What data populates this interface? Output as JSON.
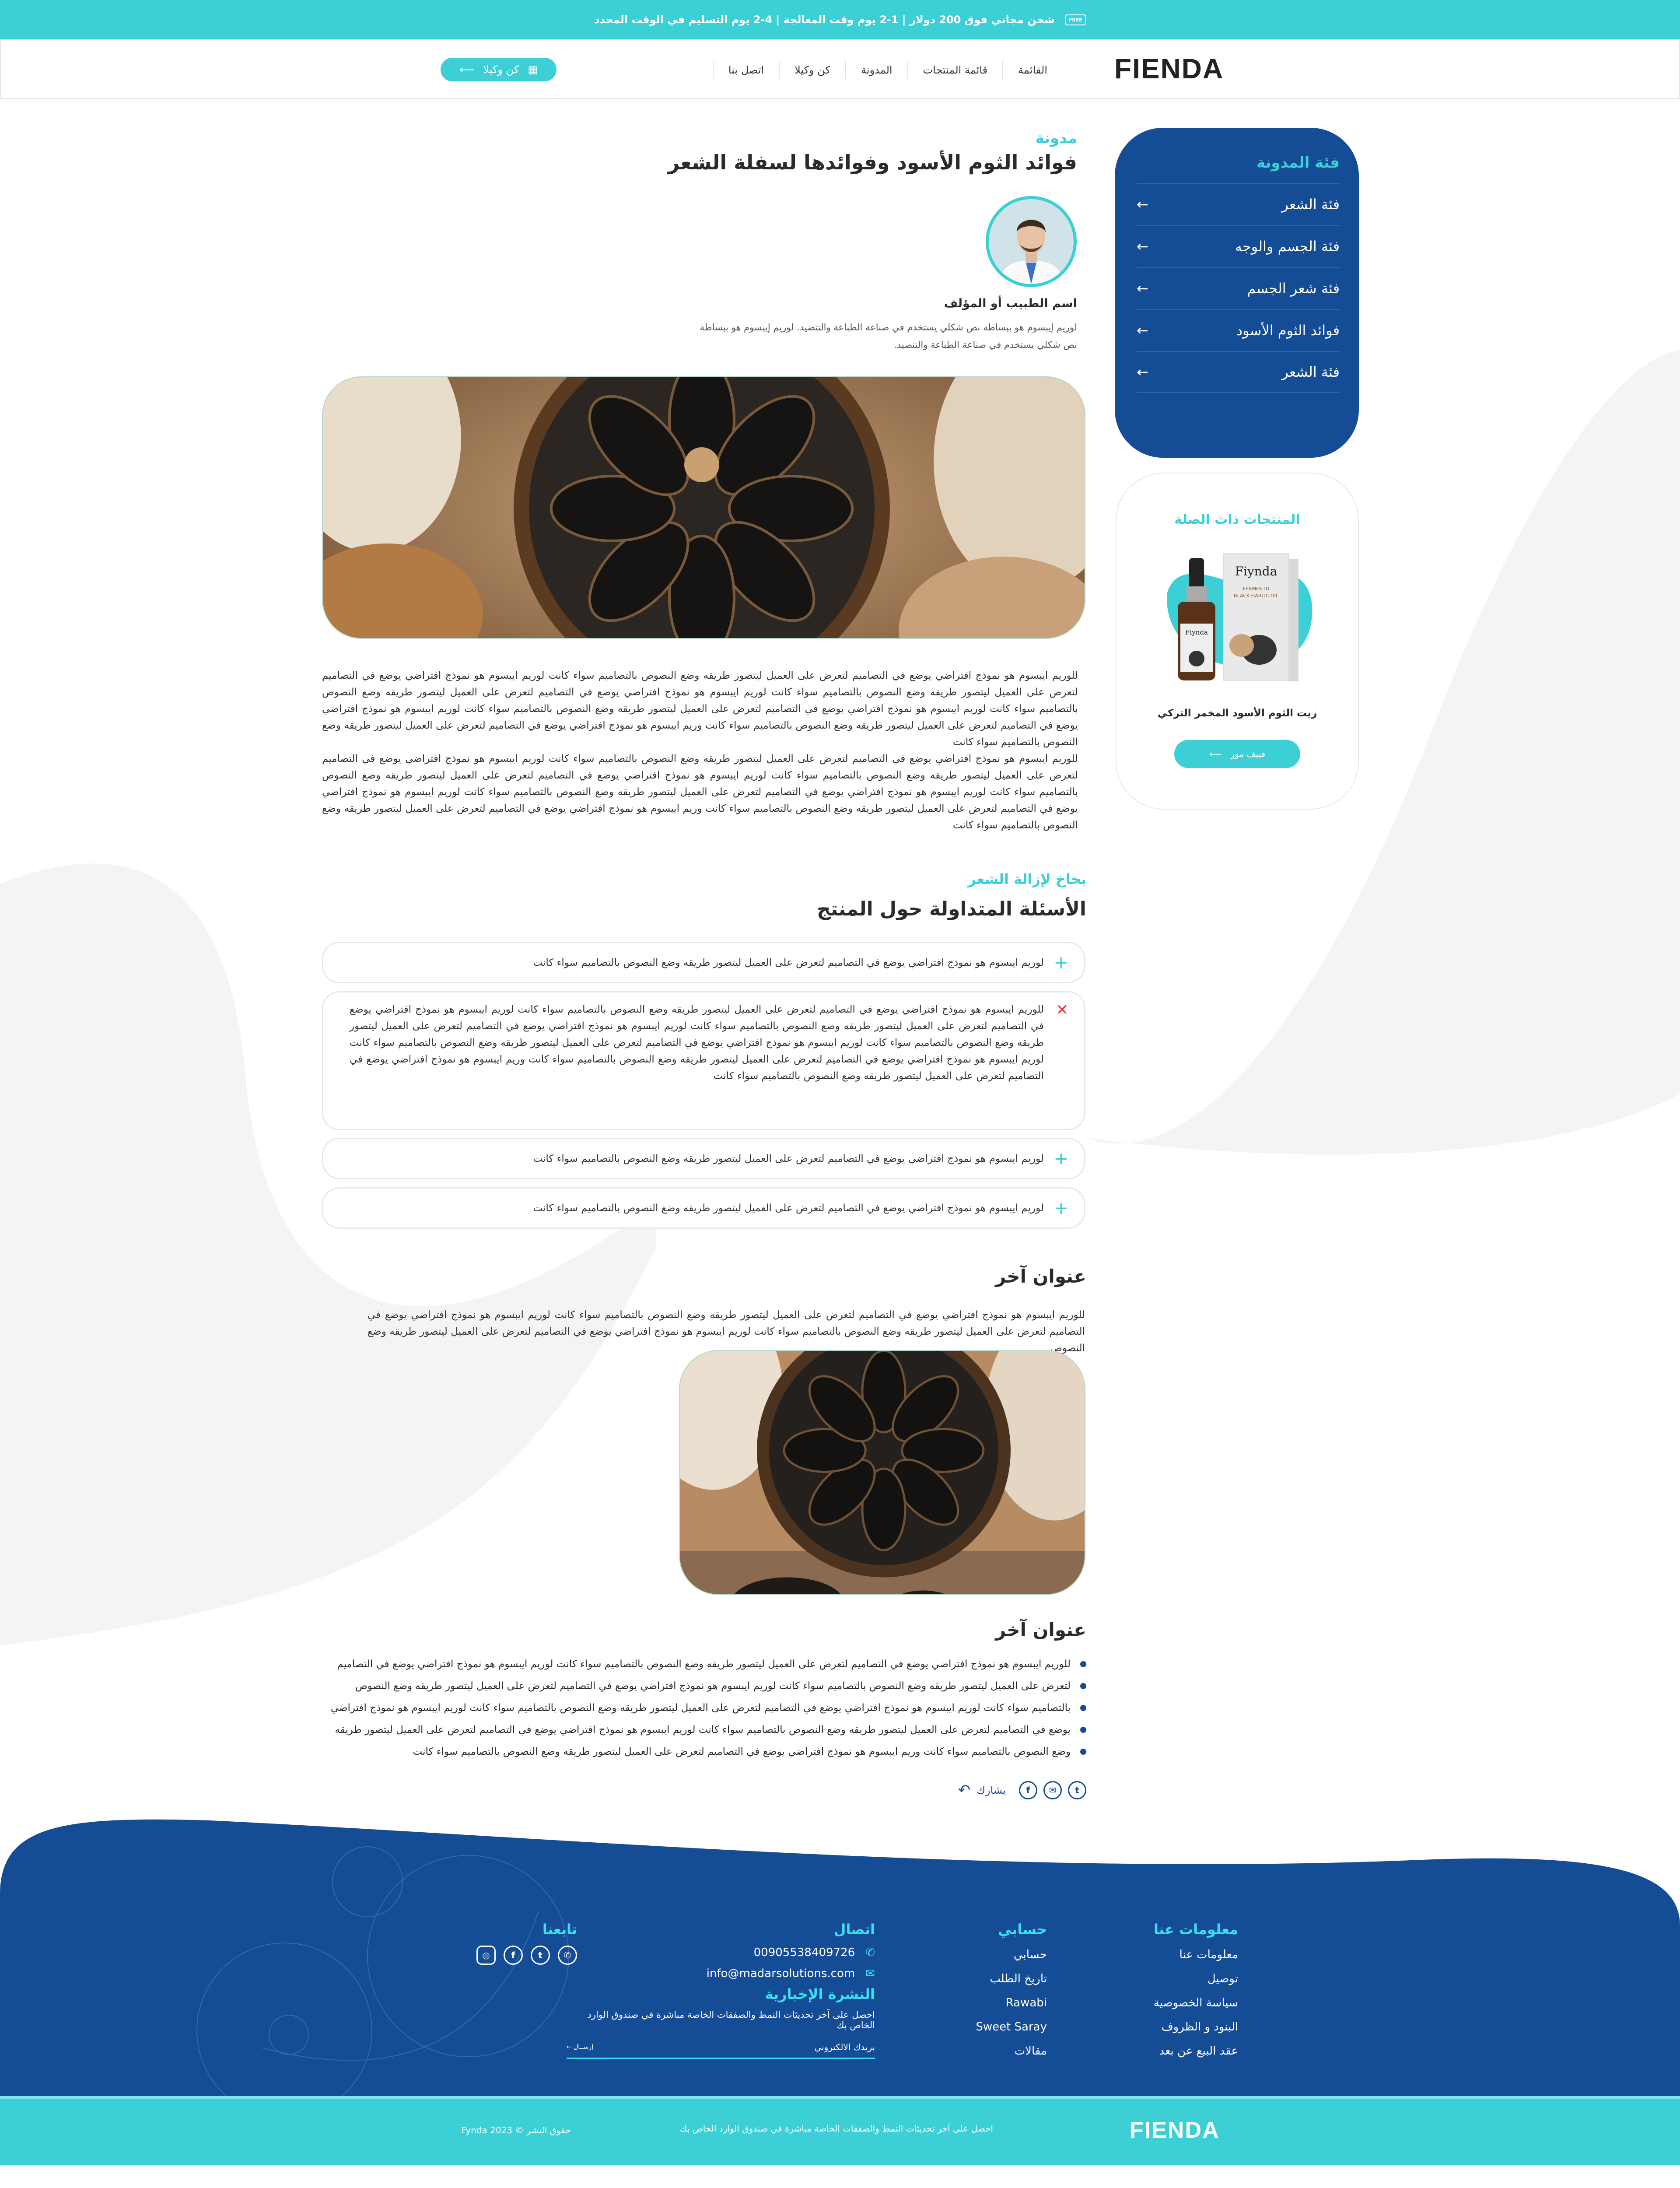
{
  "topbar": {
    "icon": "free-delivery-truck-icon",
    "badge": "FREE",
    "text": "شحن مجاني فوق 200 دولار | 1-2 يوم وقت المعالجة | 4-2 يوم التسليم في الوقت المحدد"
  },
  "header": {
    "logo": "FIENDA",
    "nav": [
      "القائمة",
      "قائمة المنتجات",
      "المدونة",
      "كن وكيلا",
      "اتصل بنا"
    ],
    "cta_label": "كن وكيلا",
    "cta_icon": "store-icon"
  },
  "sidebar": {
    "title": "فئة المدونة",
    "items": [
      "فئة الشعر",
      "فئة الجسم والوجه",
      "فئة شعر الجسم",
      "فوائد الثوم الأسود",
      "فئة الشعر"
    ]
  },
  "related": {
    "title": "المنتجات ذات الصلة",
    "brand": "Fiynda",
    "product_line1": "FERMENTD",
    "product_line2": "BLACK GARLIC OIL",
    "product_name": "زيت الثوم الأسود المخمر التركي",
    "button": "فييف مور"
  },
  "article": {
    "tag": "مدونة",
    "title": "فوائد الثوم الأسود وفوائدها لسفلة الشعر",
    "author": "اسم الطبيب أو المؤلف",
    "author_bio": "لوريم إيبسوم هو ببساطة نص شكلي يستخدم في صناعة الطباعة والتنضيد. لوريم إيبسوم هو ببساطة نص شكلي يستخدم في صناعة الطباعة والتنضيد.",
    "paragraphs": [
      "للوريم ايبسوم هو نموذج افتراضي يوضع في التصاميم لتعرض على العميل ليتصور طريقه وضع النصوص بالتصاميم سواء كانت لوريم ايبسوم هو نموذج افتراضي يوضع في التصاميم لتعرض على العميل ليتصور طريقه وضع النصوص بالتصاميم سواء كانت لوريم ايبسوم هو نموذج افتراضي يوضع في التصاميم لتعرض على العميل ليتصور طريقه وضع النصوص بالتصاميم سواء كانت لوريم ايبسوم هو نموذج افتراضي يوضع في التصاميم لتعرض على العميل ليتصور طريقه وضع النصوص بالتصاميم سواء كانت لوريم ايبسوم هو نموذج افتراضي يوضع في التصاميم لتعرض على العميل ليتصور طريقه وضع النصوص بالتصاميم سواء كانت وريم ايبسوم هو نموذج افتراضي يوضع في التصاميم لتعرض على العميل ليتصور طريقه وضع النصوص بالتصاميم سواء كانت",
      "للوريم ايبسوم هو نموذج افتراضي يوضع في التصاميم لتعرض على العميل ليتصور طريقه وضع النصوص بالتصاميم سواء كانت لوريم ايبسوم هو نموذج افتراضي يوضع في التصاميم لتعرض على العميل ليتصور طريقه وضع النصوص بالتصاميم سواء كانت لوريم ايبسوم هو نموذج افتراضي يوضع في التصاميم لتعرض على العميل ليتصور طريقه وضع النصوص بالتصاميم سواء كانت لوريم ايبسوم هو نموذج افتراضي يوضع في التصاميم لتعرض على العميل ليتصور طريقه وضع النصوص بالتصاميم سواء كانت لوريم ايبسوم هو نموذج افتراضي يوضع في التصاميم لتعرض على العميل ليتصور طريقه وضع النصوص بالتصاميم سواء كانت وريم ايبسوم هو نموذج افتراضي يوضع في التصاميم لتعرض على العميل ليتصور طريقه وضع النصوص بالتصاميم سواء كانت"
    ]
  },
  "faq": {
    "tag": "بخاخ لإزالة الشعر",
    "title": "الأسئلة المتداولة حول المنتج",
    "items": [
      {
        "q": "لوريم ايبسوم هو نموذج افتراضي يوضع في التصاميم لتعرض على العميل ليتصور طريقه وضع النصوص بالتصاميم سواء كانت",
        "open": false
      },
      {
        "q": "للوريم ايبسوم هو نموذج افتراضي يوضع في التصاميم لتعرض على العميل ليتصور طريقه وضع النصوص بالتصاميم سواء كانت لوريم ايبسوم هو نموذج افتراضي يوضع في التصاميم لتعرض على العميل ليتصور طريقه وضع النصوص بالتصاميم سواء كانت لوريم ايبسوم هو نموذج افتراضي يوضع في التصاميم لتعرض على العميل ليتصور طريقه وضع النصوص بالتصاميم سواء كانت لوريم ايبسوم هو نموذج افتراضي يوضع في التصاميم لتعرض على العميل ليتصور طريقه وضع النصوص بالتصاميم سواء كانت لوريم ايبسوم هو نموذج افتراضي يوضع في التصاميم لتعرض على العميل ليتصور طريقه وضع النصوص بالتصاميم سواء كانت وريم ايبسوم هو نموذج افتراضي يوضع في التصاميم لتعرض على العميل ليتصور طريقه وضع النصوص بالتصاميم سواء كانت",
        "open": true
      },
      {
        "q": "لوريم ايبسوم هو نموذج افتراضي يوضع في التصاميم لتعرض على العميل ليتصور طريقه وضع النصوص بالتصاميم سواء كانت",
        "open": false
      },
      {
        "q": "لوريم ايبسوم هو نموذج افتراضي يوضع في التصاميم لتعرض على العميل ليتصور طريقه وضع النصوص بالتصاميم سواء كانت",
        "open": false
      }
    ]
  },
  "section2": {
    "title": "عنوان آخر",
    "text": "للوريم ايبسوم هو نموذج افتراضي يوضع في التصاميم لتعرض على العميل ليتصور طريقه وضع النصوص بالتصاميم سواء كانت لوريم ايبسوم هو نموذج افتراضي يوضع في التصاميم لتعرض على العميل ليتصور طريقه وضع النصوص بالتصاميم سواء كانت لوريم ايبسوم هو نموذج افتراضي يوضع في التصاميم لتعرض على العميل ليتصور طريقه وضع النصوص"
  },
  "section3": {
    "title": "عنوان آخر",
    "bullets": [
      "للوريم ايبسوم هو نموذج افتراضي يوضع في التصاميم لتعرض على العميل ليتصور طريقه وضع النصوص بالتصاميم سواء كانت لوريم ايبسوم هو نموذج افتراضي يوضع في التصاميم",
      "لتعرض على العميل ليتصور طريقه وضع النصوص بالتصاميم سواء كانت لوريم ايبسوم هو نموذج افتراضي يوضع في التصاميم لتعرض على العميل ليتصور طريقه وضع النصوص",
      "بالتصاميم سواء كانت لوريم ايبسوم هو نموذج افتراضي يوضع في التصاميم لتعرض على العميل ليتصور طريقه وضع النصوص بالتصاميم سواء كانت لوريم ايبسوم هو نموذج افتراضي",
      "يوضع في التصاميم لتعرض على العميل ليتصور طريقه وضع النصوص بالتصاميم سواء كانت لوريم ايبسوم هو نموذج افتراضي يوضع في التصاميم لتعرض على العميل ليتصور طريقه",
      "وضع النصوص بالتصاميم سواء كانت وريم ايبسوم هو نموذج افتراضي يوضع في التصاميم لتعرض على العميل ليتصور طريقه وضع النصوص بالتصاميم سواء كانت"
    ]
  },
  "share": {
    "label": "يشارك",
    "icons": [
      "twitter-icon",
      "mail-icon",
      "facebook-icon",
      "share-icon"
    ]
  },
  "footer": {
    "about": {
      "title": "معلومات عنا",
      "links": [
        "معلومات عنا",
        "توصيل",
        "سياسة الخصوصية",
        "البنود و الظروف",
        "عقد البيع عن بعد"
      ]
    },
    "account": {
      "title": "حسابي",
      "links": [
        "حسابي",
        "تاريخ الطلب",
        "Rawabi",
        "Sweet Saray",
        "مقالات"
      ]
    },
    "contact": {
      "title": "اتصال",
      "phone": "00905538409726",
      "email": "info@madarsolutions.com"
    },
    "newsletter": {
      "title": "النشرة الإخبارية",
      "desc": "احصل على آخر تحديثات النمط والصفقات الخاصة مباشرة في صندوق الوارد الخاص بك",
      "placeholder": "بريدك الالكتروني",
      "submit": "إرســال"
    },
    "follow": {
      "title": "تابعنا",
      "icons": [
        "whatsapp-icon",
        "twitter-icon",
        "facebook-icon",
        "instagram-icon"
      ]
    },
    "bottom": {
      "logo": "FIENDA",
      "text": "احصل على آخر تحديثات النمط والصفقات الخاصة مباشرة في صندوق الوارد الخاص بك",
      "copyright": "حقوق النشر © Fynda 2023"
    }
  },
  "colors": {
    "teal": "#3ccfd6",
    "navy": "#154c96",
    "footer_heading": "#3ce0f0",
    "close": "#e53935"
  }
}
